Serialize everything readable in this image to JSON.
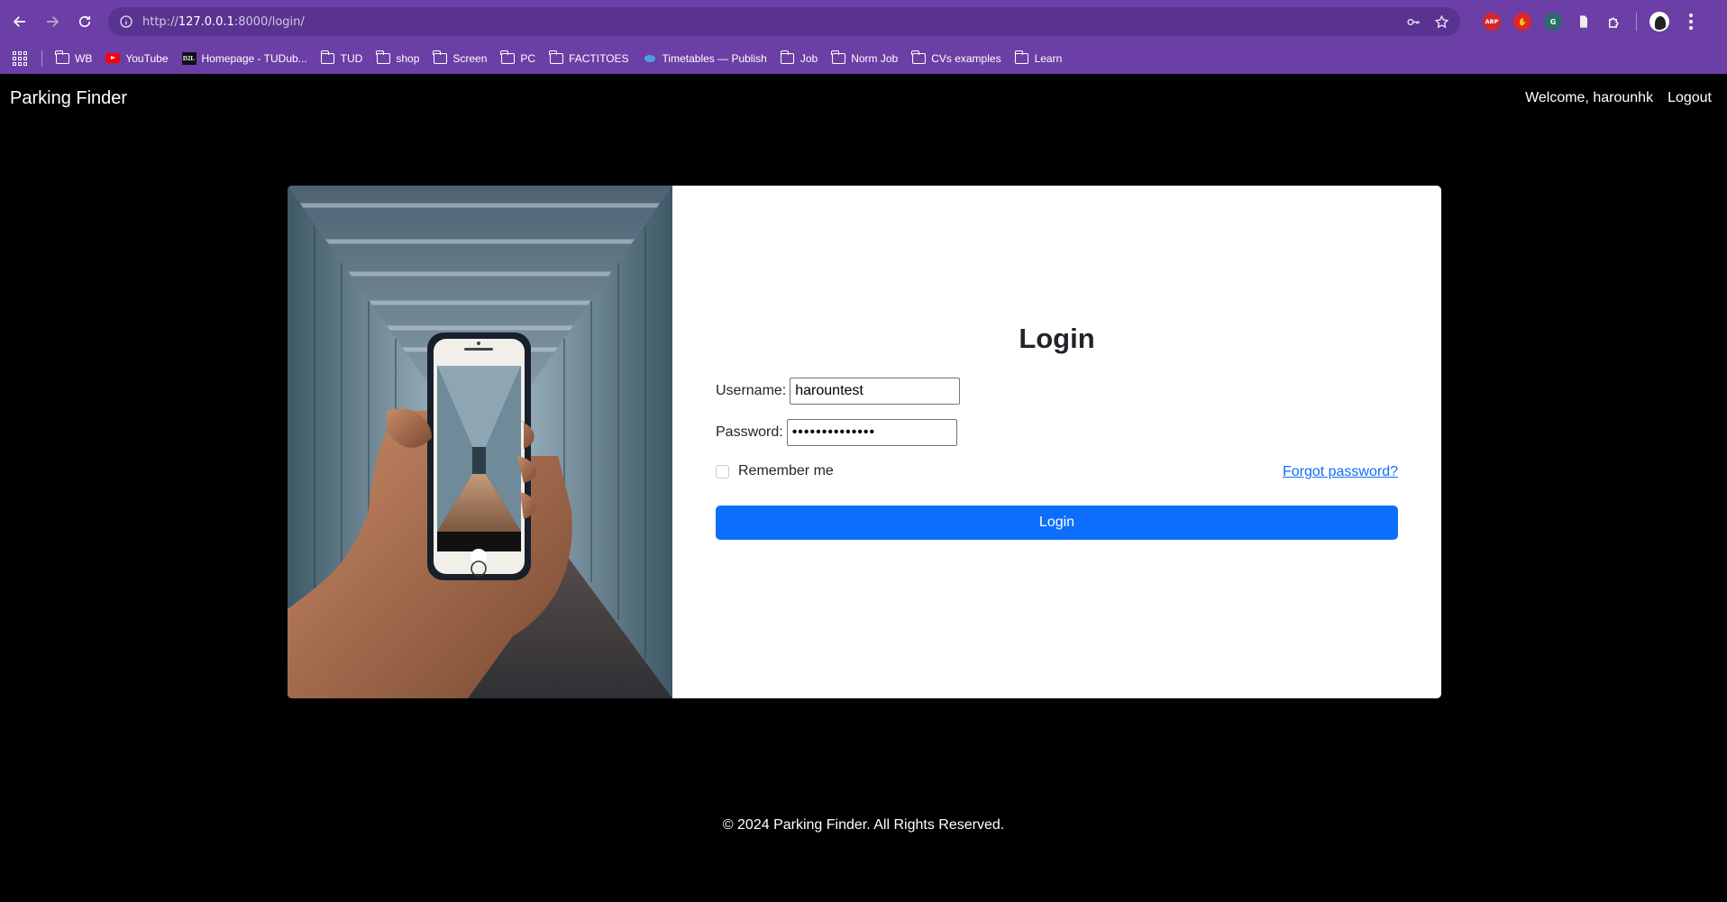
{
  "browser": {
    "url_scheme": "http://",
    "url_host": "127.0.0.1",
    "url_path": ":8000/login/",
    "bookmarks": [
      {
        "label": "WB",
        "icon": "folder-icon"
      },
      {
        "label": "YouTube",
        "icon": "youtube-icon"
      },
      {
        "label": "Homepage - TUDub...",
        "icon": "d2l-icon"
      },
      {
        "label": "TUD",
        "icon": "folder-icon"
      },
      {
        "label": "shop",
        "icon": "folder-icon"
      },
      {
        "label": "Screen",
        "icon": "folder-icon"
      },
      {
        "label": "PC",
        "icon": "folder-icon"
      },
      {
        "label": "FACTITOES",
        "icon": "folder-icon"
      },
      {
        "label": "Timetables — Publish",
        "icon": "timetables-icon"
      },
      {
        "label": "Job",
        "icon": "folder-icon"
      },
      {
        "label": "Norm Job",
        "icon": "folder-icon"
      },
      {
        "label": "CVs examples",
        "icon": "folder-icon"
      },
      {
        "label": "Learn",
        "icon": "folder-icon"
      }
    ],
    "extensions": {
      "abp": "ABP"
    },
    "colors": {
      "chrome": "#6b3fa5",
      "omnibox": "#5a3391"
    }
  },
  "navbar": {
    "brand": "Parking Finder",
    "welcome": "Welcome, harounhk",
    "logout": "Logout"
  },
  "login": {
    "title": "Login",
    "username_label": "Username:",
    "username_value": "harountest",
    "password_label": "Password:",
    "password_value": "••••••••••••••",
    "remember_label": "Remember me",
    "forgot_link": "Forgot password?",
    "submit_label": "Login"
  },
  "footer": {
    "text": "© 2024 Parking Finder. All Rights Reserved."
  },
  "colors": {
    "page_bg": "#000000",
    "card_bg": "#ffffff",
    "primary": "#0d6efd"
  }
}
